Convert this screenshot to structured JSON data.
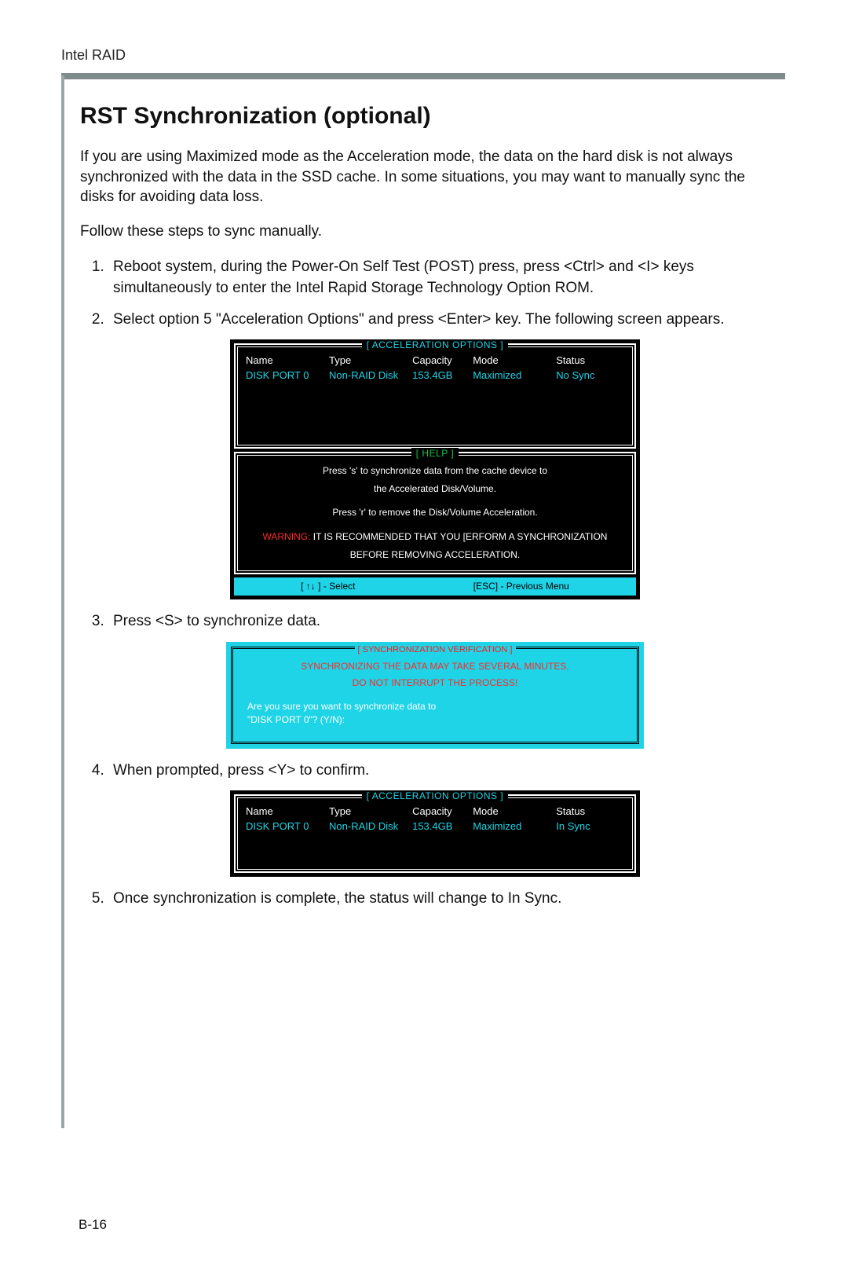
{
  "running_head": "Intel RAID",
  "title": "RST Synchronization (optional)",
  "intro": "If you are using Maximized mode as the Acceleration mode, the data on the hard disk is not always synchronized with the data in the SSD cache. In some situations, you may want to manually sync the disks for avoiding data loss.",
  "follow": "Follow these steps to sync manually.",
  "steps": {
    "s1": "Reboot system, during the Power-On Self Test (POST) press, press <Ctrl> and <I> keys simultaneously to enter the Intel Rapid Storage Technology Option ROM.",
    "s2": "Select option 5 \"Acceleration Options\" and press <Enter> key. The following screen appears.",
    "s3": "Press <S> to synchronize data.",
    "s4": "When prompted, press <Y> to confirm.",
    "s5": "Once synchronization is complete, the status will change to In Sync."
  },
  "accel": {
    "title": "[ ACCELERATION OPTIONS ]",
    "headers": {
      "name": "Name",
      "type": "Type",
      "capacity": "Capacity",
      "mode": "Mode",
      "status": "Status"
    },
    "row1": {
      "name": "DISK PORT 0",
      "type": "Non-RAID Disk",
      "capacity": "153.4GB",
      "mode": "Maximized",
      "status": "No Sync"
    },
    "row2": {
      "name": "DISK PORT 0",
      "type": "Non-RAID Disk",
      "capacity": "153.4GB",
      "mode": "Maximized",
      "status": "In Sync"
    }
  },
  "help": {
    "title": "[  HELP  ]",
    "l1": "Press 's' to synchronize data from the cache device to",
    "l2": "the Accelerated Disk/Volume.",
    "l3": "Press 'r' to remove the Disk/Volume Acceleration.",
    "warn_label": "WARNING:",
    "warn_text": " IT IS RECOMMENDED THAT YOU [ERFORM A SYNCHRONIZATION",
    "l5": "BEFORE REMOVING ACCELERATION."
  },
  "footerbar": {
    "left": "[ ↑↓ ] - Select",
    "right": "[ESC] - Previous Menu"
  },
  "sync": {
    "title": "[ SYNCHRONIZATION VERIFICATION ]",
    "l1": "SYNCHRONIZING THE DATA MAY TAKE SEVERAL MINUTES.",
    "l2": "DO NOT INTERRUPT THE PROCESS!",
    "l3": "Are you sure you want to synchronize data to",
    "l4": "\"DISK PORT 0\"? (Y/N):"
  },
  "page_number": "B-16"
}
